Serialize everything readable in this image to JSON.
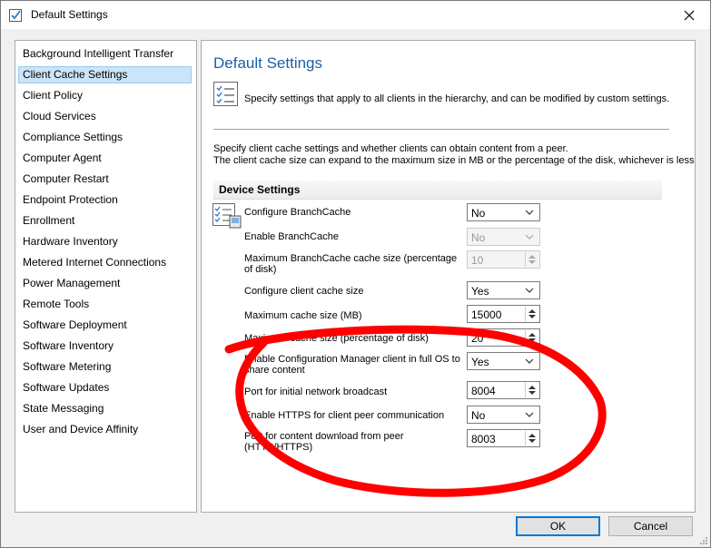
{
  "window": {
    "title": "Default Settings",
    "close_glyph": "✕"
  },
  "nav": {
    "items": [
      "Background Intelligent Transfer",
      "Client Cache Settings",
      "Client Policy",
      "Cloud Services",
      "Compliance Settings",
      "Computer Agent",
      "Computer Restart",
      "Endpoint Protection",
      "Enrollment",
      "Hardware Inventory",
      "Metered Internet Connections",
      "Power Management",
      "Remote Tools",
      "Software Deployment",
      "Software Inventory",
      "Software Metering",
      "Software Updates",
      "State Messaging",
      "User and Device Affinity"
    ],
    "selected": "Client Cache Settings"
  },
  "content": {
    "title": "Default Settings",
    "header_desc": "Specify settings that apply to all clients in the hierarchy, and can be modified by custom settings.",
    "desc_line1": "Specify client cache settings and whether clients can obtain content from a peer.",
    "desc_line2": "The client cache size can expand to the maximum size in MB or the percentage of the disk, whichever is less.",
    "section_title": "Device Settings"
  },
  "settings": [
    {
      "label": "Configure BranchCache",
      "value": "No",
      "control": "dropdown",
      "enabled": true
    },
    {
      "label": "Enable BranchCache",
      "value": "No",
      "control": "dropdown",
      "enabled": false
    },
    {
      "label": "Maximum BranchCache cache size (percentage of disk)",
      "value": "10",
      "control": "spinner",
      "enabled": false
    },
    {
      "label": "Configure client cache size",
      "value": "Yes",
      "control": "dropdown",
      "enabled": true
    },
    {
      "label": "Maximum cache size (MB)",
      "value": "15000",
      "control": "spinner",
      "enabled": true
    },
    {
      "label": "Maximum cache size (percentage of disk)",
      "value": "20",
      "control": "spinner",
      "enabled": true
    },
    {
      "label": "Enable Configuration Manager client in full OS to share content",
      "value": "Yes",
      "control": "dropdown",
      "enabled": true
    },
    {
      "label": "Port for initial network broadcast",
      "value": "8004",
      "control": "spinner",
      "enabled": true
    },
    {
      "label": "Enable HTTPS for client peer communication",
      "value": "No",
      "control": "dropdown",
      "enabled": true
    },
    {
      "label": "Port for content download from peer (HTTP/HTTPS)",
      "value": "8003",
      "control": "spinner",
      "enabled": true
    }
  ],
  "buttons": {
    "ok": "OK",
    "cancel": "Cancel"
  },
  "colors": {
    "title_blue": "#1f5fa8",
    "selection": "#cce4f7",
    "annotation_red": "#ff0000"
  },
  "icons": {
    "window": "settings-checklist-icon",
    "header": "checklist-icon",
    "device": "device-settings-icon"
  }
}
